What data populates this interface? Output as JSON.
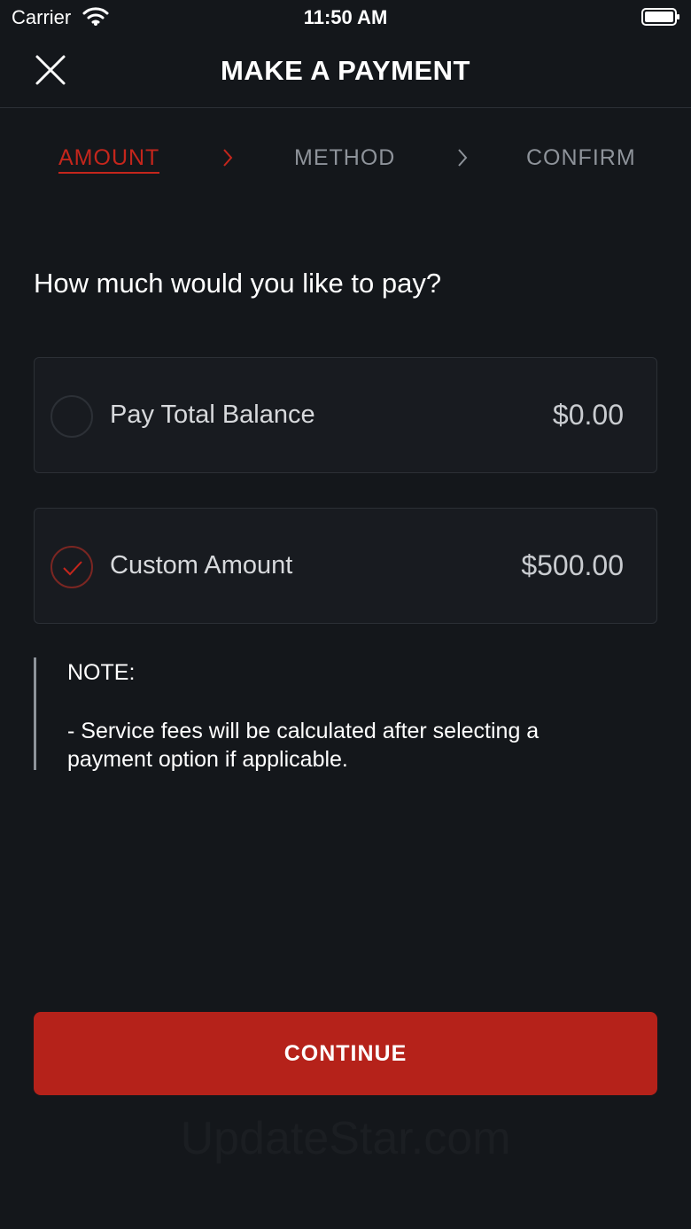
{
  "status_bar": {
    "carrier": "Carrier",
    "time": "11:50 AM"
  },
  "header": {
    "title": "MAKE A PAYMENT"
  },
  "stepper": {
    "steps": [
      {
        "label": "AMOUNT",
        "active": true
      },
      {
        "label": "METHOD",
        "active": false
      },
      {
        "label": "CONFIRM",
        "active": false
      }
    ]
  },
  "question": "How much would you like to pay?",
  "options": [
    {
      "label": "Pay Total Balance",
      "amount": "$0.00",
      "selected": false
    },
    {
      "label": "Custom Amount",
      "amount": "$500.00",
      "selected": true
    }
  ],
  "note": {
    "title": "NOTE:",
    "body": " - Service fees will be calculated after selecting a payment option if applicable."
  },
  "continue_label": "CONTINUE",
  "watermark": "UpdateStar.com",
  "colors": {
    "background": "#14171b",
    "accent": "#c4261c",
    "button": "#b5221a",
    "card": "#181b20",
    "muted": "#8e939a"
  }
}
